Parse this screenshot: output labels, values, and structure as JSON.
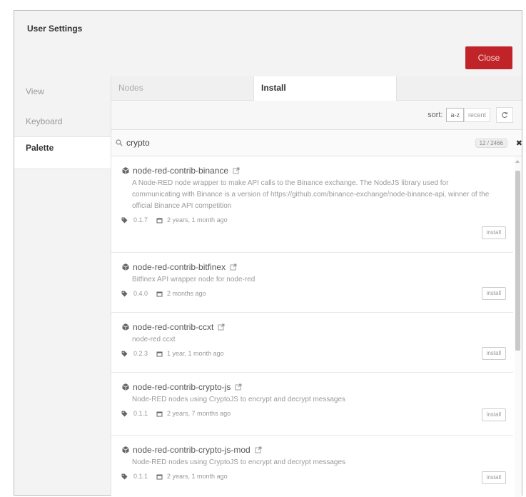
{
  "dialog": {
    "title": "User Settings",
    "close_label": "Close"
  },
  "nav": {
    "items": [
      {
        "label": "View"
      },
      {
        "label": "Keyboard"
      },
      {
        "label": "Palette"
      }
    ]
  },
  "tabs": [
    {
      "label": "Nodes"
    },
    {
      "label": "Install"
    }
  ],
  "sort": {
    "label": "sort:",
    "options": [
      {
        "label": "a-z"
      },
      {
        "label": "recent"
      }
    ]
  },
  "search": {
    "value": "crypto",
    "count_badge": "12 / 2466"
  },
  "packages": [
    {
      "name": "node-red-contrib-binance",
      "description": "A Node-RED node wrapper to make API calls to the Binance exchange. The NodeJS library used for communicating with Binance is a version of https://github.com/binance-exchange/node-binance-api, winner of the official Binance API competition",
      "version": "0.1.7",
      "updated": "2 years, 1 month ago",
      "install_label": "install"
    },
    {
      "name": "node-red-contrib-bitfinex",
      "description": "Bitfinex API wrapper node for node-red",
      "version": "0.4.0",
      "updated": "2 months ago",
      "install_label": "install"
    },
    {
      "name": "node-red-contrib-ccxt",
      "description": "node-red ccxt",
      "version": "0.2.3",
      "updated": "1 year, 1 month ago",
      "install_label": "install"
    },
    {
      "name": "node-red-contrib-crypto-js",
      "description": "Node-RED nodes using CryptoJS to encrypt and decrypt messages",
      "version": "0.1.1",
      "updated": "2 years, 7 months ago",
      "install_label": "install"
    },
    {
      "name": "node-red-contrib-crypto-js-mod",
      "description": "Node-RED nodes using CryptoJS to encrypt and decrypt messages",
      "version": "0.1.1",
      "updated": "2 years, 1 month ago",
      "install_label": "install"
    }
  ]
}
